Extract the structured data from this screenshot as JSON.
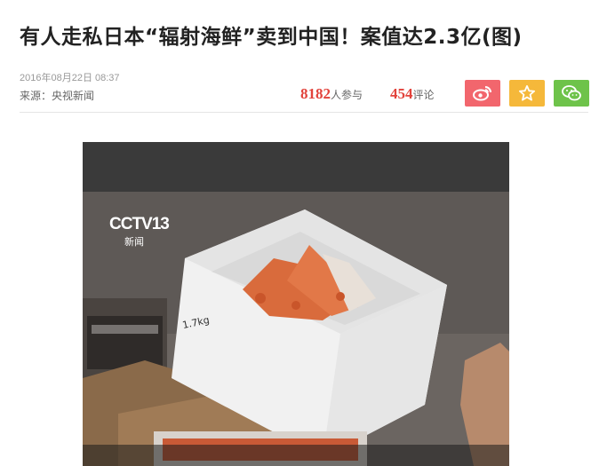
{
  "article": {
    "title": "有人走私日本“辐射海鲜”卖到中国！案值达2.3亿(图)",
    "date": "2016年08月22日 08:37",
    "source": "来源：央视新闻",
    "participants_count": "8182",
    "participants_label": "人参与",
    "comments_count": "454",
    "comments_label": "评论"
  },
  "share": [
    {
      "name": "weibo-icon",
      "color": "#f2666d"
    },
    {
      "name": "star-icon",
      "color": "#f5b83a"
    },
    {
      "name": "wechat-icon",
      "color": "#6ec34a"
    }
  ],
  "video": {
    "channel_logo": "CCTV13",
    "channel_sub": "新闻",
    "box_label": "1.7kg"
  }
}
